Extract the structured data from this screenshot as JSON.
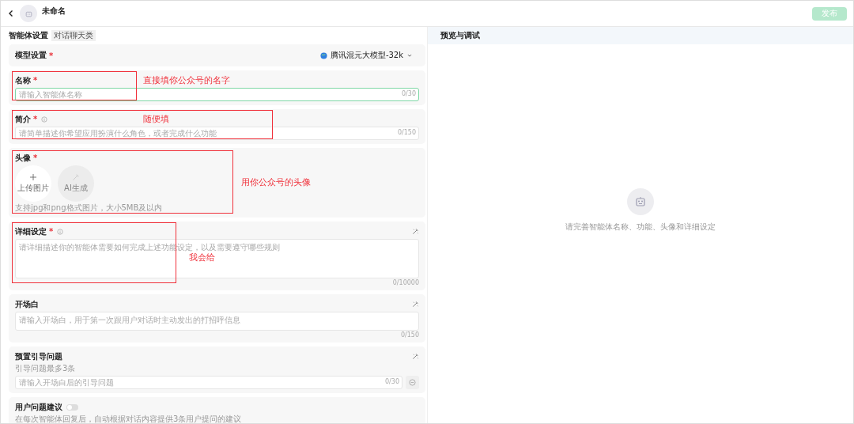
{
  "header": {
    "title": "未命名",
    "publish_button": {
      "label": "发布",
      "disabled": true
    }
  },
  "settings": {
    "title": "智能体设置",
    "tag": "对话聊天类",
    "model": {
      "label": "模型设置",
      "required_mark": "*",
      "value": "腾讯混元大模型-32k"
    },
    "sections": [
      {
        "kind": "input",
        "label": "名称",
        "required_mark": "*",
        "info": false,
        "ai_button": false,
        "placeholder": "请输入智能体名称",
        "counter": "0/30",
        "focused": true,
        "annotation": "直接填你公众号的名字"
      },
      {
        "kind": "input",
        "label": "简介",
        "required_mark": "*",
        "info": true,
        "ai_button": false,
        "placeholder": "请简单描述你希望应用扮演什么角色，或者完成什么功能",
        "counter": "0/150",
        "focused": false,
        "annotation": "随便填"
      },
      {
        "kind": "avatar",
        "label": "头像",
        "required_mark": "*",
        "info": false,
        "ai_button": false,
        "upload_label": "上传图片",
        "ai_label": "AI生成",
        "hint": "支持jpg和png格式图片，大小5MB及以内",
        "annotation": "用你公众号的头像"
      },
      {
        "kind": "textarea",
        "label": "详细设定",
        "required_mark": "*",
        "info": true,
        "ai_button": true,
        "placeholder": "请详细描述你的智能体需要如何完成上述功能设定，以及需要遵守哪些规则",
        "counter": "0/10000",
        "focused": false,
        "annotation": "我会给"
      },
      {
        "kind": "textarea",
        "label": "开场白",
        "info": false,
        "ai_button": true,
        "placeholder": "请输入开场白，用于第一次跟用户对话时主动发出的打招呼信息",
        "counter": "0/150",
        "focused": false
      },
      {
        "kind": "questions",
        "label": "预置引导问题",
        "info": false,
        "ai_button": true,
        "hint": "引导问题最多3条",
        "placeholder": "请输入开场白后的引导问题",
        "counter": "0/30",
        "focused": false
      },
      {
        "kind": "toggle",
        "label": "用户问题建议",
        "info": false,
        "ai_button": false,
        "on": false,
        "hint": "在每次智能体回复后，自动根据对话内容提供3条用户提问的建议"
      }
    ]
  },
  "preview": {
    "title": "预览与调试",
    "empty_text": "请完善智能体名称、功能、头像和详细设定"
  }
}
